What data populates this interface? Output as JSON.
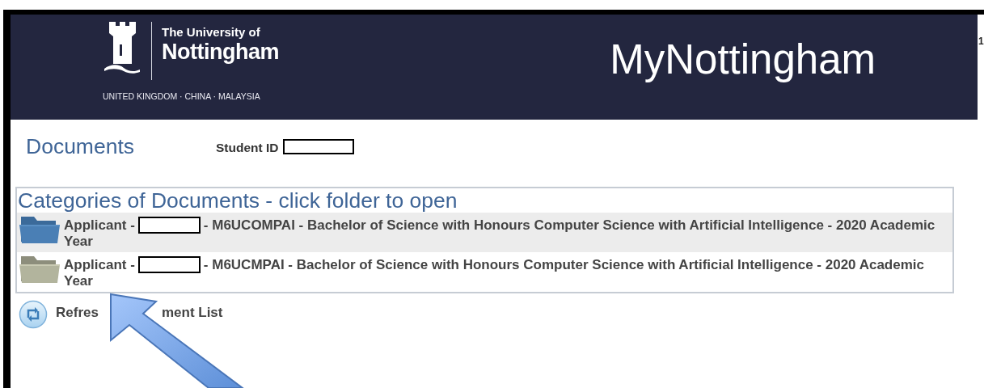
{
  "header": {
    "university_line1": "The University of",
    "university_line2": "Nottingham",
    "campuses": "UNITED KINGDOM · CHINA · MALAYSIA",
    "portal_title": "MyNottingham",
    "edge_text": "1"
  },
  "page": {
    "title": "Documents",
    "student_id_label": "Student ID"
  },
  "categories": {
    "heading": "Categories of Documents - click folder to open",
    "rows": [
      {
        "prefix": "Applicant -",
        "title": "- M6UCOMPAI - Bachelor of Science with Honours Computer Science with Artificial Intelligence - 2020 Academic Year",
        "selected": true
      },
      {
        "prefix": "Applicant -",
        "title": "- M6UCMPAI - Bachelor of Science with Honours Computer Science with Artificial Intelligence - 2020 Academic Year",
        "selected": false
      }
    ]
  },
  "refresh": {
    "text_before": "Refres",
    "text_after": "ment List"
  }
}
